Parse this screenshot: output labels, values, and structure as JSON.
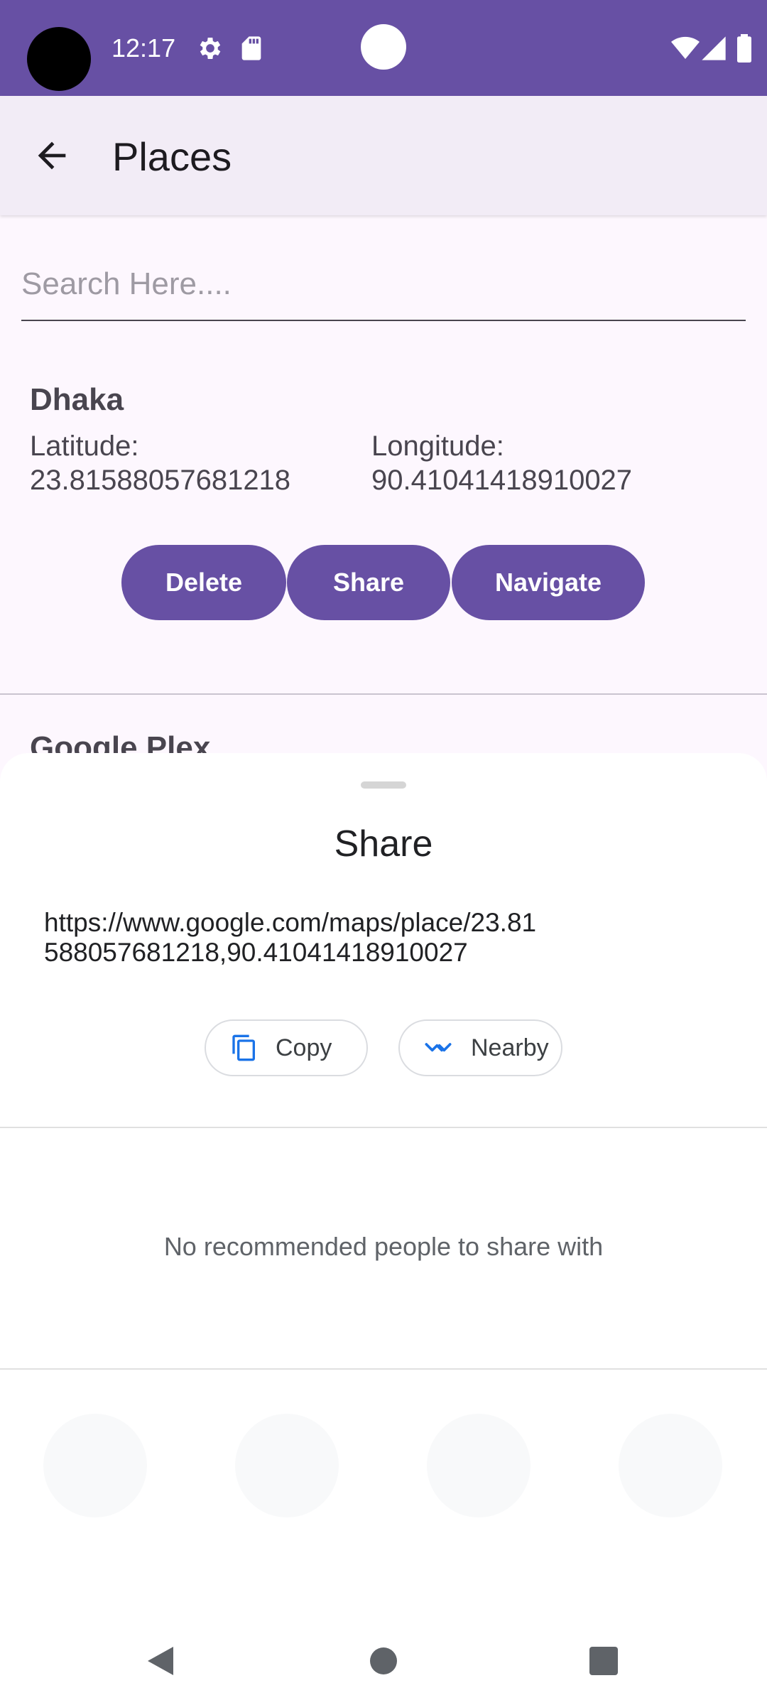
{
  "status_bar": {
    "time": "12:17",
    "icons": [
      "settings-icon",
      "sd-card-icon",
      "wifi-icon",
      "signal-icon",
      "battery-icon"
    ]
  },
  "app_bar": {
    "title": "Places",
    "back_icon": "arrow-back-icon"
  },
  "search": {
    "placeholder": "Search Here...."
  },
  "place": {
    "name": "Dhaka",
    "latitude_label": "Latitude:",
    "latitude_value": "23.81588057681218",
    "longitude_label": "Longitude:",
    "longitude_value": "90.41041418910027",
    "buttons": {
      "delete": "Delete",
      "share": "Share",
      "navigate": "Navigate"
    }
  },
  "next_place": {
    "name": "Google Plex"
  },
  "share_sheet": {
    "title": "Share",
    "url": "https://www.google.com/maps/place/23.81588057681218,90.41041418910027",
    "chips": {
      "copy": "Copy",
      "nearby": "Nearby"
    },
    "no_recommendations": "No recommended people to share with"
  },
  "colors": {
    "primary": "#6750a4",
    "app_bar_bg": "#f2ecf6",
    "chip_icon": "#1a73e8"
  }
}
